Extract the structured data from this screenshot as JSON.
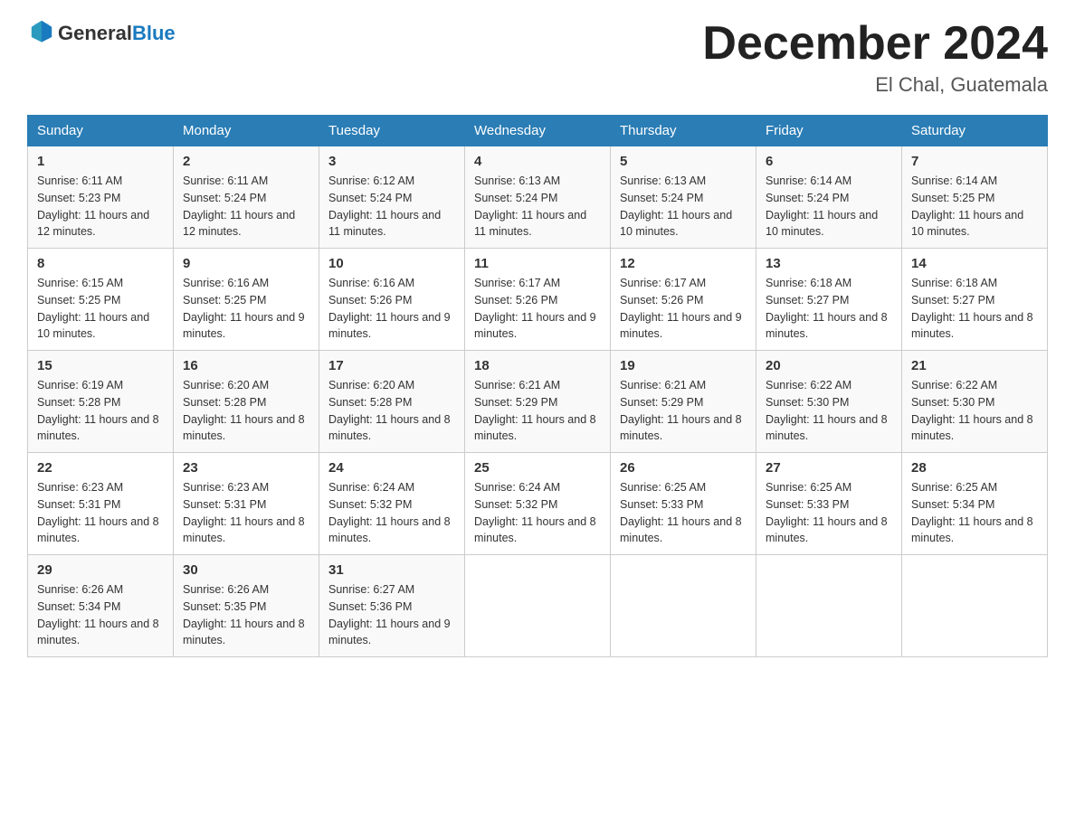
{
  "header": {
    "logo_general": "General",
    "logo_blue": "Blue",
    "title": "December 2024",
    "subtitle": "El Chal, Guatemala"
  },
  "days_of_week": [
    "Sunday",
    "Monday",
    "Tuesday",
    "Wednesday",
    "Thursday",
    "Friday",
    "Saturday"
  ],
  "weeks": [
    [
      {
        "num": "1",
        "sunrise": "6:11 AM",
        "sunset": "5:23 PM",
        "daylight": "11 hours and 12 minutes."
      },
      {
        "num": "2",
        "sunrise": "6:11 AM",
        "sunset": "5:24 PM",
        "daylight": "11 hours and 12 minutes."
      },
      {
        "num": "3",
        "sunrise": "6:12 AM",
        "sunset": "5:24 PM",
        "daylight": "11 hours and 11 minutes."
      },
      {
        "num": "4",
        "sunrise": "6:13 AM",
        "sunset": "5:24 PM",
        "daylight": "11 hours and 11 minutes."
      },
      {
        "num": "5",
        "sunrise": "6:13 AM",
        "sunset": "5:24 PM",
        "daylight": "11 hours and 10 minutes."
      },
      {
        "num": "6",
        "sunrise": "6:14 AM",
        "sunset": "5:24 PM",
        "daylight": "11 hours and 10 minutes."
      },
      {
        "num": "7",
        "sunrise": "6:14 AM",
        "sunset": "5:25 PM",
        "daylight": "11 hours and 10 minutes."
      }
    ],
    [
      {
        "num": "8",
        "sunrise": "6:15 AM",
        "sunset": "5:25 PM",
        "daylight": "11 hours and 10 minutes."
      },
      {
        "num": "9",
        "sunrise": "6:16 AM",
        "sunset": "5:25 PM",
        "daylight": "11 hours and 9 minutes."
      },
      {
        "num": "10",
        "sunrise": "6:16 AM",
        "sunset": "5:26 PM",
        "daylight": "11 hours and 9 minutes."
      },
      {
        "num": "11",
        "sunrise": "6:17 AM",
        "sunset": "5:26 PM",
        "daylight": "11 hours and 9 minutes."
      },
      {
        "num": "12",
        "sunrise": "6:17 AM",
        "sunset": "5:26 PM",
        "daylight": "11 hours and 9 minutes."
      },
      {
        "num": "13",
        "sunrise": "6:18 AM",
        "sunset": "5:27 PM",
        "daylight": "11 hours and 8 minutes."
      },
      {
        "num": "14",
        "sunrise": "6:18 AM",
        "sunset": "5:27 PM",
        "daylight": "11 hours and 8 minutes."
      }
    ],
    [
      {
        "num": "15",
        "sunrise": "6:19 AM",
        "sunset": "5:28 PM",
        "daylight": "11 hours and 8 minutes."
      },
      {
        "num": "16",
        "sunrise": "6:20 AM",
        "sunset": "5:28 PM",
        "daylight": "11 hours and 8 minutes."
      },
      {
        "num": "17",
        "sunrise": "6:20 AM",
        "sunset": "5:28 PM",
        "daylight": "11 hours and 8 minutes."
      },
      {
        "num": "18",
        "sunrise": "6:21 AM",
        "sunset": "5:29 PM",
        "daylight": "11 hours and 8 minutes."
      },
      {
        "num": "19",
        "sunrise": "6:21 AM",
        "sunset": "5:29 PM",
        "daylight": "11 hours and 8 minutes."
      },
      {
        "num": "20",
        "sunrise": "6:22 AM",
        "sunset": "5:30 PM",
        "daylight": "11 hours and 8 minutes."
      },
      {
        "num": "21",
        "sunrise": "6:22 AM",
        "sunset": "5:30 PM",
        "daylight": "11 hours and 8 minutes."
      }
    ],
    [
      {
        "num": "22",
        "sunrise": "6:23 AM",
        "sunset": "5:31 PM",
        "daylight": "11 hours and 8 minutes."
      },
      {
        "num": "23",
        "sunrise": "6:23 AM",
        "sunset": "5:31 PM",
        "daylight": "11 hours and 8 minutes."
      },
      {
        "num": "24",
        "sunrise": "6:24 AM",
        "sunset": "5:32 PM",
        "daylight": "11 hours and 8 minutes."
      },
      {
        "num": "25",
        "sunrise": "6:24 AM",
        "sunset": "5:32 PM",
        "daylight": "11 hours and 8 minutes."
      },
      {
        "num": "26",
        "sunrise": "6:25 AM",
        "sunset": "5:33 PM",
        "daylight": "11 hours and 8 minutes."
      },
      {
        "num": "27",
        "sunrise": "6:25 AM",
        "sunset": "5:33 PM",
        "daylight": "11 hours and 8 minutes."
      },
      {
        "num": "28",
        "sunrise": "6:25 AM",
        "sunset": "5:34 PM",
        "daylight": "11 hours and 8 minutes."
      }
    ],
    [
      {
        "num": "29",
        "sunrise": "6:26 AM",
        "sunset": "5:34 PM",
        "daylight": "11 hours and 8 minutes."
      },
      {
        "num": "30",
        "sunrise": "6:26 AM",
        "sunset": "5:35 PM",
        "daylight": "11 hours and 8 minutes."
      },
      {
        "num": "31",
        "sunrise": "6:27 AM",
        "sunset": "5:36 PM",
        "daylight": "11 hours and 9 minutes."
      },
      null,
      null,
      null,
      null
    ]
  ],
  "labels": {
    "sunrise": "Sunrise:",
    "sunset": "Sunset:",
    "daylight": "Daylight:"
  }
}
